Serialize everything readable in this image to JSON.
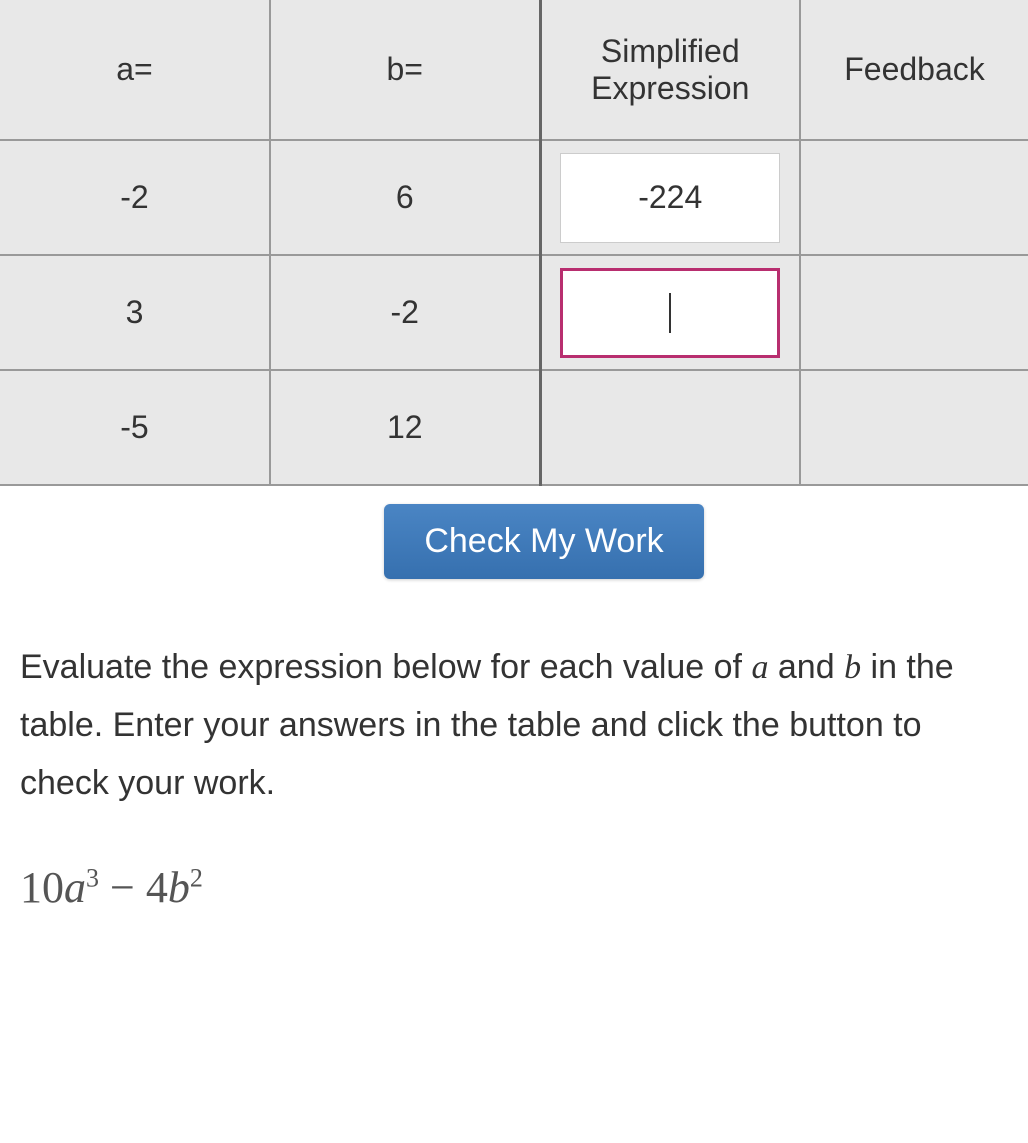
{
  "table": {
    "headers": {
      "a": "a=",
      "b": "b=",
      "expression": "Simplified Expression",
      "feedback": "Feedback"
    },
    "rows": [
      {
        "a": "-2",
        "b": "6",
        "answer": "-224",
        "feedback": ""
      },
      {
        "a": "3",
        "b": "-2",
        "answer": "",
        "feedback": ""
      },
      {
        "a": "-5",
        "b": "12",
        "answer": "",
        "feedback": ""
      }
    ]
  },
  "button": {
    "check_label": "Check My Work"
  },
  "instructions": {
    "text_part1": "Evaluate the expression below for each value of ",
    "var_a": "a",
    "text_part2": " and ",
    "var_b": "b",
    "text_part3": " in the table.  Enter your answers in the table and click the button to check your work."
  },
  "expression": {
    "coef1": "10",
    "var1": "a",
    "exp1": "3",
    "op": " − ",
    "coef2": "4",
    "var2": "b",
    "exp2": "2"
  }
}
